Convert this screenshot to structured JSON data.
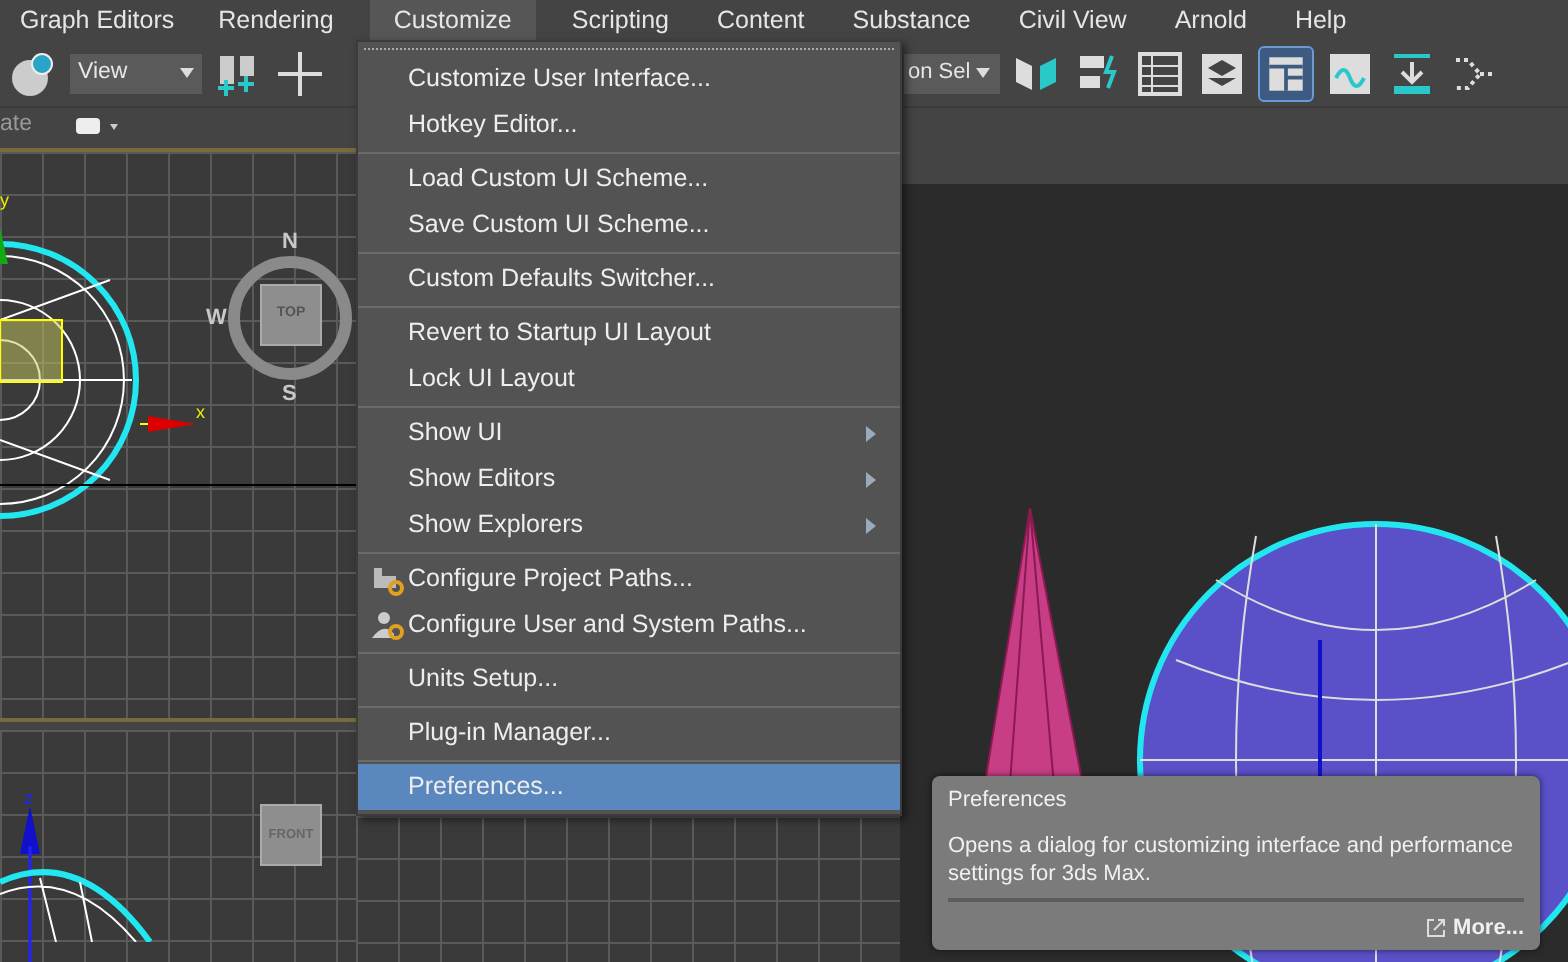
{
  "menubar": {
    "items": [
      {
        "label": "Graph Editors",
        "selected": false
      },
      {
        "label": "Rendering",
        "selected": false
      },
      {
        "label": "Customize",
        "selected": true
      },
      {
        "label": "Scripting",
        "selected": false
      },
      {
        "label": "Content",
        "selected": false
      },
      {
        "label": "Substance",
        "selected": false
      },
      {
        "label": "Civil View",
        "selected": false
      },
      {
        "label": "Arnold",
        "selected": false
      },
      {
        "label": "Help",
        "selected": false
      }
    ]
  },
  "toolbar": {
    "view_dropdown": "View",
    "selection_set_dropdown": "on Sel",
    "row2_text": "ate"
  },
  "menu": {
    "groups": [
      [
        {
          "label": "Customize User Interface...",
          "kind": "plain",
          "selected": false
        },
        {
          "label": "Hotkey Editor...",
          "kind": "plain",
          "selected": false
        }
      ],
      [
        {
          "label": "Load Custom UI Scheme...",
          "kind": "plain",
          "selected": false
        },
        {
          "label": "Save Custom UI Scheme...",
          "kind": "plain",
          "selected": false
        }
      ],
      [
        {
          "label": "Custom Defaults Switcher...",
          "kind": "plain",
          "selected": false
        }
      ],
      [
        {
          "label": "Revert to Startup UI Layout",
          "kind": "plain",
          "selected": false
        },
        {
          "label": "Lock UI Layout",
          "kind": "plain",
          "selected": false
        }
      ],
      [
        {
          "label": "Show UI",
          "kind": "submenu",
          "selected": false
        },
        {
          "label": "Show Editors",
          "kind": "submenu",
          "selected": false
        },
        {
          "label": "Show Explorers",
          "kind": "submenu",
          "selected": false
        }
      ],
      [
        {
          "label": "Configure Project Paths...",
          "kind": "foldergear",
          "selected": false
        },
        {
          "label": "Configure User and System Paths...",
          "kind": "usergear",
          "selected": false
        }
      ],
      [
        {
          "label": "Units Setup...",
          "kind": "plain",
          "selected": false
        }
      ],
      [
        {
          "label": "Plug-in Manager...",
          "kind": "plain",
          "selected": false
        }
      ],
      [
        {
          "label": "Preferences...",
          "kind": "plain",
          "selected": true
        }
      ]
    ]
  },
  "tooltip": {
    "title": "Preferences",
    "description": "Opens a dialog for customizing interface and performance settings for 3ds Max.",
    "link": "More..."
  },
  "viewports": {
    "top": {
      "compass": [
        "N",
        "W",
        "S"
      ],
      "cube_label": "TOP",
      "axes": [
        "y",
        "x"
      ]
    },
    "front": {
      "cube_label": "FRONT",
      "axes": [
        "z"
      ]
    }
  }
}
